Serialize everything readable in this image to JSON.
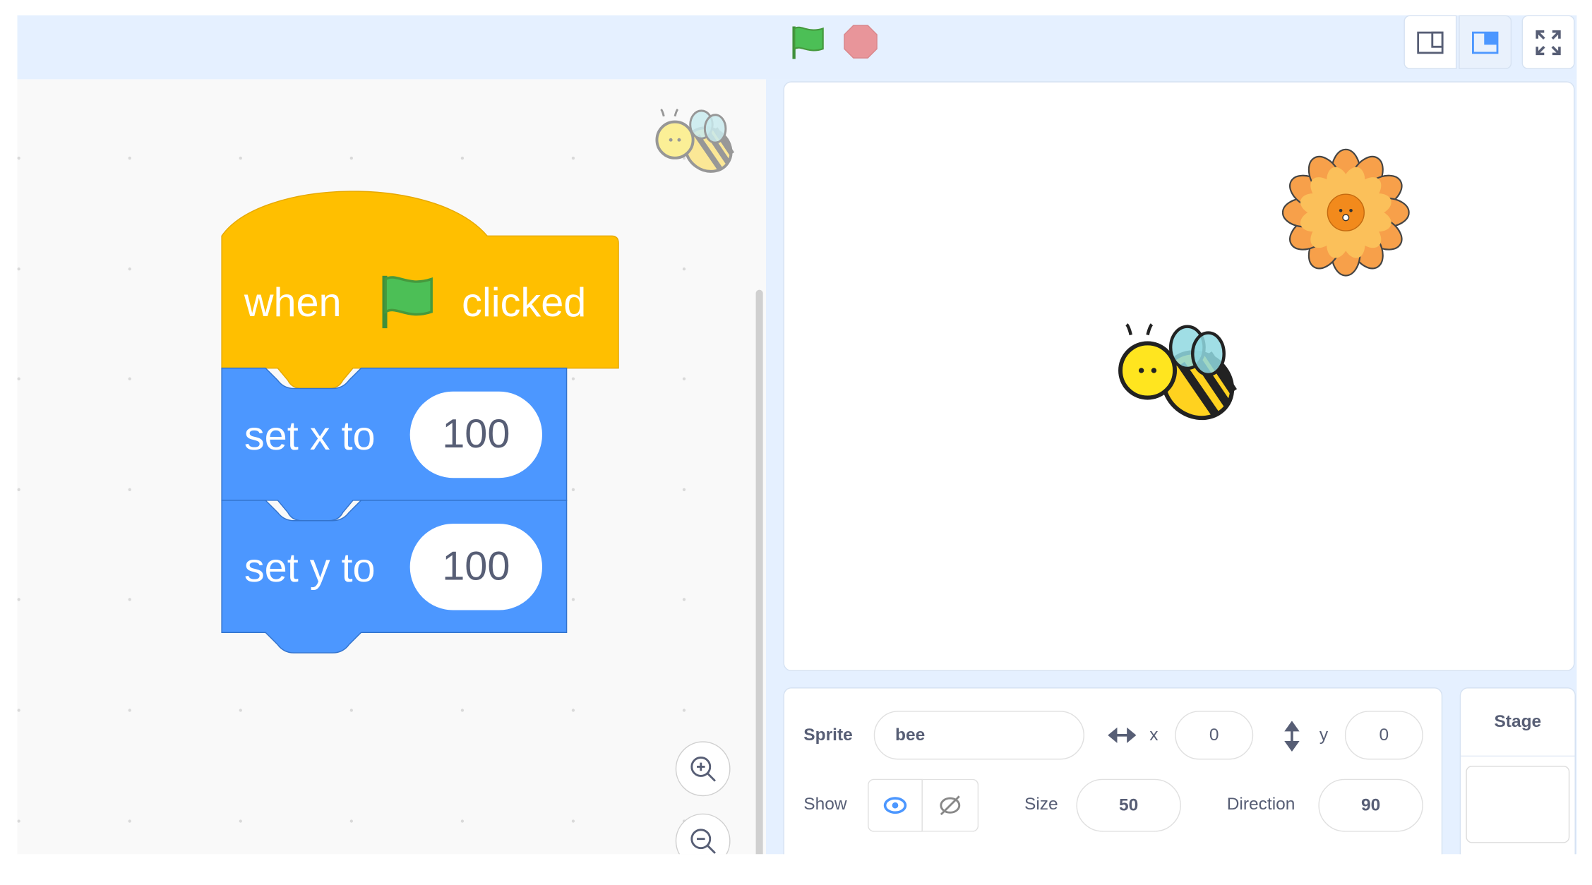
{
  "toolbar": {
    "green_flag": "green-flag-icon",
    "stop": "stop-icon",
    "layout_buttons": [
      "small-stage-icon",
      "normal-stage-icon",
      "fullscreen-icon"
    ],
    "selected_layout": "normal-stage"
  },
  "colors": {
    "events": "#ffbf00",
    "motion": "#4c97ff",
    "topbar": "#e5f0ff",
    "accent": "#4c97ff",
    "stop": "#e8959a"
  },
  "script": {
    "hat": {
      "before": "when",
      "after": "clicked"
    },
    "blocks": [
      {
        "label": "set x to",
        "value": "100"
      },
      {
        "label": "set y to",
        "value": "100"
      }
    ]
  },
  "sprite_info": {
    "sprite_label": "Sprite",
    "sprite_name": "bee",
    "x_label": "x",
    "x_value": "0",
    "y_label": "y",
    "y_value": "0",
    "show_label": "Show",
    "size_label": "Size",
    "size_value": "50",
    "direction_label": "Direction",
    "direction_value": "90"
  },
  "stage_panel": {
    "title": "Stage"
  }
}
